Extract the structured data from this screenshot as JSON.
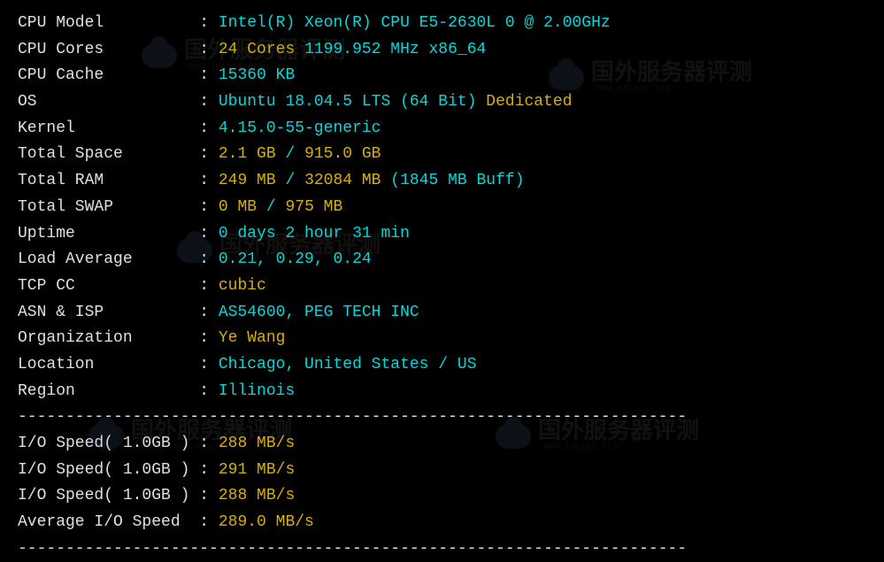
{
  "labels": {
    "cpu_model": "CPU Model",
    "cpu_cores": "CPU Cores",
    "cpu_cache": "CPU Cache",
    "os": "OS",
    "kernel": "Kernel",
    "total_space": "Total Space",
    "total_ram": "Total RAM",
    "total_swap": "Total SWAP",
    "uptime": "Uptime",
    "load_avg": "Load Average",
    "tcp_cc": "TCP CC",
    "asn_isp": "ASN & ISP",
    "organization": "Organization",
    "location": "Location",
    "region": "Region",
    "io_speed": "I/O Speed( 1.0GB )",
    "avg_io": "Average I/O Speed"
  },
  "values": {
    "cpu_model": "Intel(R) Xeon(R) CPU E5-2630L 0 @ 2.00GHz",
    "cpu_cores_count": "24 Cores",
    "cpu_cores_freq": " 1199.952 MHz x86_64",
    "cpu_cache": "15360 KB",
    "os": "Ubuntu 18.04.5 LTS (64 Bit)",
    "os_dedicated": " Dedicated",
    "kernel": "4.15.0-55-generic",
    "space_used": "2.1 GB",
    "space_sep": " / ",
    "space_total": "915.0 GB",
    "ram_used": "249 MB",
    "ram_sep": " / ",
    "ram_total": "32084 MB",
    "ram_buff": " (1845 MB Buff)",
    "swap_used": "0 MB",
    "swap_sep": " / ",
    "swap_total": "975 MB",
    "uptime": "0 days 2 hour 31 min",
    "load_avg": "0.21, 0.29, 0.24",
    "tcp_cc": "cubic",
    "asn_isp": "AS54600, PEG TECH INC",
    "organization": "Ye Wang",
    "location": "Chicago, United States / US",
    "region": "Illinois",
    "io1": "288 MB/s",
    "io2": "291 MB/s",
    "io3": "288 MB/s",
    "avg_io": "289.0 MB/s"
  },
  "watermark": {
    "text": "国外服务器评测",
    "sub": "-www.idcspy.org-"
  },
  "divider": "----------------------------------------------------------------------"
}
